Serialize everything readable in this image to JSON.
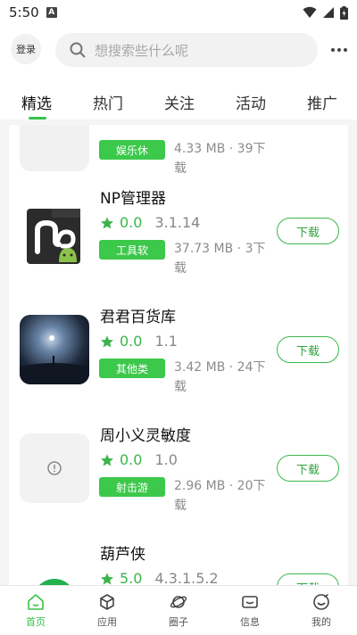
{
  "status": {
    "time": "5:50",
    "notif_letter": "A"
  },
  "header": {
    "login_label": "登录",
    "search_placeholder": "想搜索些什么呢",
    "more_icon": "more-dots-icon"
  },
  "tabs": [
    {
      "label": "精选",
      "active": true
    },
    {
      "label": "热门"
    },
    {
      "label": "关注"
    },
    {
      "label": "活动"
    },
    {
      "label": "推广"
    }
  ],
  "apps": [
    {
      "name": "",
      "category": "娱乐休",
      "meta_line1": "4.33 MB · 39下",
      "meta_line2": "载"
    },
    {
      "name": "NP管理器",
      "rating": "0.0",
      "version": "3.1.14",
      "category": "工具软",
      "meta_line1": "37.73 MB · 3下",
      "meta_line2": "载",
      "download_label": "下载"
    },
    {
      "name": "君君百货库",
      "rating": "0.0",
      "version": "1.1",
      "category": "其他类",
      "meta_line1": "3.42 MB · 24下",
      "meta_line2": "载",
      "download_label": "下载"
    },
    {
      "name": "周小义灵敏度",
      "rating": "0.0",
      "version": "1.0",
      "category": "射击游",
      "meta_line1": "2.96 MB · 20下",
      "meta_line2": "载",
      "download_label": "下载"
    },
    {
      "name": "葫芦侠",
      "rating": "5.0",
      "version": "4.3.1.5.2",
      "download_label": "下载"
    }
  ],
  "bottom_nav": [
    {
      "label": "首页",
      "icon": "home-icon",
      "active": true
    },
    {
      "label": "应用",
      "icon": "cube-icon"
    },
    {
      "label": "圈子",
      "icon": "planet-icon"
    },
    {
      "label": "信息",
      "icon": "message-icon"
    },
    {
      "label": "我的",
      "icon": "smile-icon"
    }
  ],
  "colors": {
    "accent": "#37c34a",
    "tag_bg": "#3cc84b",
    "rating": "#3bb54a"
  }
}
